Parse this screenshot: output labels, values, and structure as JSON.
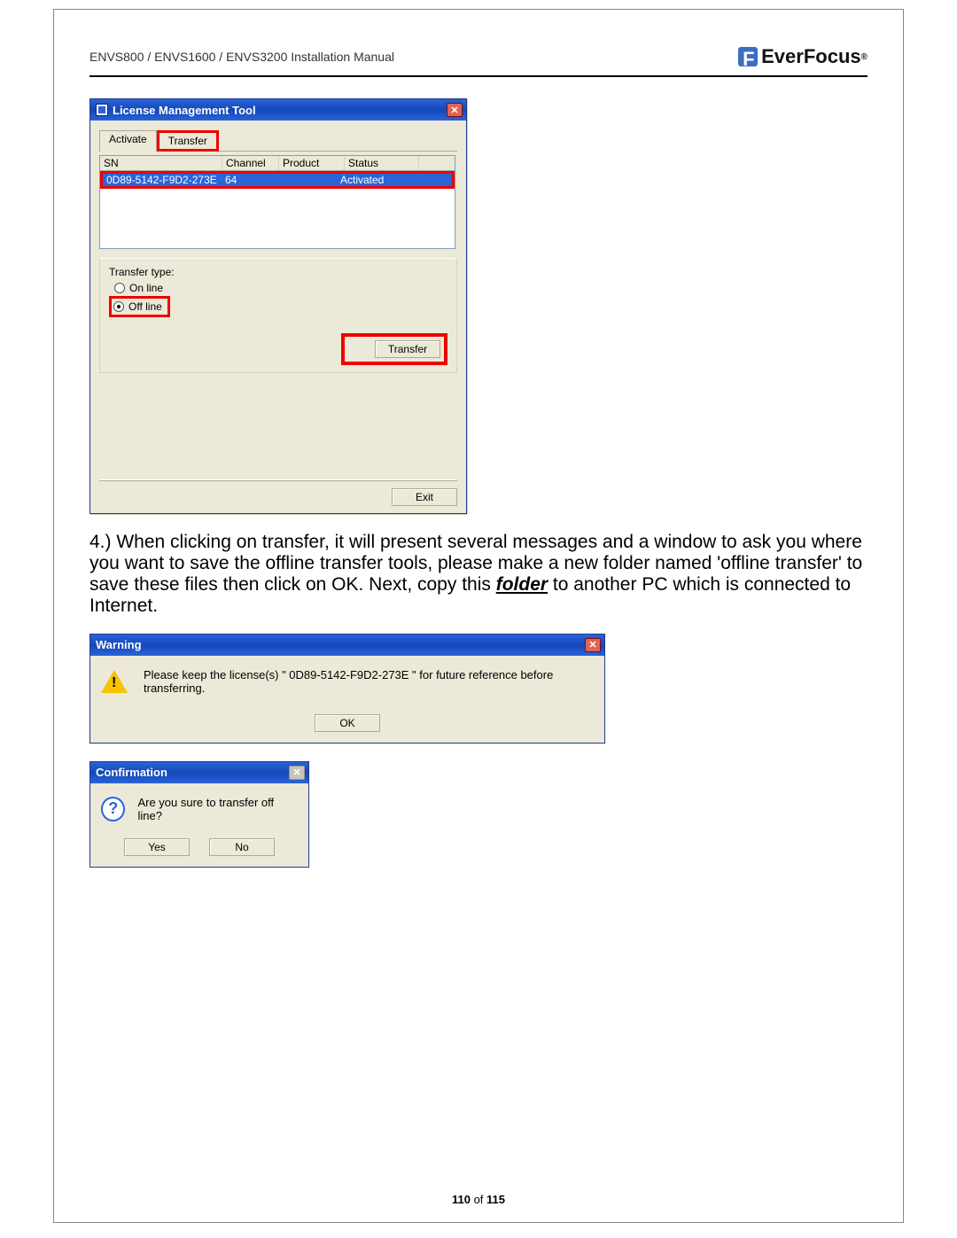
{
  "header": {
    "manual_title": "ENVS800 / ENVS1600 / ENVS3200 Installation Manual",
    "brand": "EverFocus"
  },
  "lmt": {
    "title": "License Management Tool",
    "tabs": {
      "activate": "Activate",
      "transfer": "Transfer"
    },
    "columns": {
      "sn": "SN",
      "channel": "Channel",
      "product": "Product",
      "status": "Status"
    },
    "row": {
      "sn": "0D89-5142-F9D2-273E",
      "channel": "64",
      "product": "",
      "status": "Activated"
    },
    "transfer_type_label": "Transfer type:",
    "radio_online": "On line",
    "radio_offline": "Off line",
    "transfer_btn": "Transfer",
    "exit_btn": "Exit"
  },
  "instruction": {
    "prefix": "4.) When clicking on transfer, it will present several messages and a window to ask you where you want to save the offline transfer tools, please make a new folder named 'offline transfer' to save these files then click on OK. Next, copy this ",
    "folder": "folder",
    "suffix": " to another PC which is connected to Internet."
  },
  "warning": {
    "title": "Warning",
    "message": "Please keep the license(s) \" 0D89-5142-F9D2-273E \" for future reference before transferring.",
    "ok": "OK"
  },
  "confirmation": {
    "title": "Confirmation",
    "message": "Are you sure to transfer off line?",
    "yes": "Yes",
    "no": "No"
  },
  "footer": {
    "page": "110",
    "of_label": "of",
    "total": "115"
  }
}
